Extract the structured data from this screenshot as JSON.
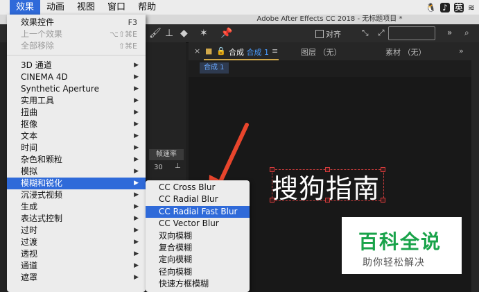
{
  "menubar": {
    "items": [
      "效果",
      "动画",
      "视图",
      "窗口",
      "帮助"
    ],
    "ime_label": "英"
  },
  "titlebar": {
    "title": "Adobe After Effects CC 2018 - 无标题项目 *"
  },
  "toolbar": {
    "snap_label": "对齐"
  },
  "effects_menu": {
    "items": [
      {
        "label": "效果控件",
        "shortcut": "F3",
        "disabled": false,
        "submenu": false
      },
      {
        "label": "上一个效果",
        "shortcut": "⌥⇧⌘E",
        "disabled": true,
        "submenu": false
      },
      {
        "label": "全部移除",
        "shortcut": "⇧⌘E",
        "disabled": true,
        "submenu": false
      },
      {
        "label": "3D 通道",
        "shortcut": "",
        "disabled": false,
        "submenu": true
      },
      {
        "label": "CINEMA 4D",
        "shortcut": "",
        "disabled": false,
        "submenu": true
      },
      {
        "label": "Synthetic Aperture",
        "shortcut": "",
        "disabled": false,
        "submenu": true
      },
      {
        "label": "实用工具",
        "shortcut": "",
        "disabled": false,
        "submenu": true
      },
      {
        "label": "扭曲",
        "shortcut": "",
        "disabled": false,
        "submenu": true
      },
      {
        "label": "抠像",
        "shortcut": "",
        "disabled": false,
        "submenu": true
      },
      {
        "label": "文本",
        "shortcut": "",
        "disabled": false,
        "submenu": true
      },
      {
        "label": "时间",
        "shortcut": "",
        "disabled": false,
        "submenu": true
      },
      {
        "label": "杂色和颗粒",
        "shortcut": "",
        "disabled": false,
        "submenu": true
      },
      {
        "label": "模拟",
        "shortcut": "",
        "disabled": false,
        "submenu": true
      },
      {
        "label": "模糊和锐化",
        "shortcut": "",
        "disabled": false,
        "submenu": true,
        "highlighted": true
      },
      {
        "label": "沉浸式视频",
        "shortcut": "",
        "disabled": false,
        "submenu": true
      },
      {
        "label": "生成",
        "shortcut": "",
        "disabled": false,
        "submenu": true
      },
      {
        "label": "表达式控制",
        "shortcut": "",
        "disabled": false,
        "submenu": true
      },
      {
        "label": "过时",
        "shortcut": "",
        "disabled": false,
        "submenu": true
      },
      {
        "label": "过渡",
        "shortcut": "",
        "disabled": false,
        "submenu": true
      },
      {
        "label": "透视",
        "shortcut": "",
        "disabled": false,
        "submenu": true
      },
      {
        "label": "通道",
        "shortcut": "",
        "disabled": false,
        "submenu": true
      },
      {
        "label": "遮罩",
        "shortcut": "",
        "disabled": false,
        "submenu": true
      }
    ]
  },
  "blur_submenu": {
    "items": [
      {
        "label": "CC Cross Blur"
      },
      {
        "label": "CC Radial Blur"
      },
      {
        "label": "CC Radial Fast Blur",
        "highlighted": true
      },
      {
        "label": "CC Vector Blur"
      },
      {
        "label": "双向模糊"
      },
      {
        "label": "复合模糊"
      },
      {
        "label": "定向模糊"
      },
      {
        "label": "径向模糊"
      },
      {
        "label": "快速方框模糊"
      }
    ]
  },
  "project_panel": {
    "rate_header": "帧速率",
    "rate_value": "30"
  },
  "comp_panel": {
    "tab_prefix": "合成",
    "tab_name": "合成 1",
    "layer_tab": "图层 （无）",
    "footage_tab": "素材 （无）",
    "sub_tab": "合成 1",
    "comp_text": "搜狗指南"
  },
  "watermark": {
    "line1": "百科全说",
    "line2": "助你轻松解决"
  },
  "colors": {
    "menu_highlight": "#2f6ad9",
    "arrow": "#e8452c",
    "tab_underline": "#d2a94b",
    "watermark_green": "#19a34a"
  }
}
